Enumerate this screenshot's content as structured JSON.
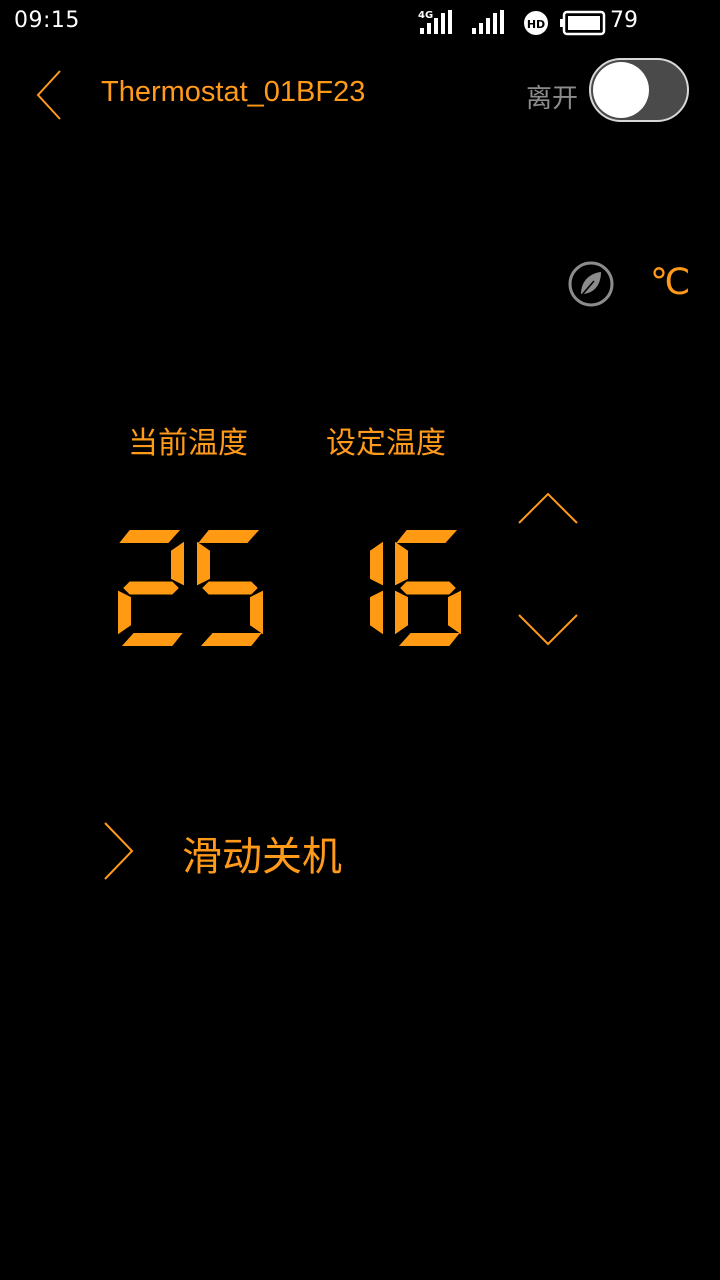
{
  "status_bar": {
    "time": "09:15",
    "network": "4G",
    "battery_percent": "79",
    "icons": [
      "signal-4g-icon",
      "signal-icon",
      "hd-icon",
      "battery-icon"
    ]
  },
  "header": {
    "title": "Thermostat_01BF23",
    "away_label": "离开",
    "away_toggle_on": false
  },
  "controls": {
    "eco_icon": "leaf-icon",
    "unit": "℃"
  },
  "temperature": {
    "current_label": "当前温度",
    "set_label": "设定温度",
    "current_value": "25",
    "set_value": "16"
  },
  "slide_off": {
    "label": "滑动关机"
  },
  "colors": {
    "accent": "#ff9a1a",
    "background": "#000000",
    "muted": "#8c8c8c"
  }
}
